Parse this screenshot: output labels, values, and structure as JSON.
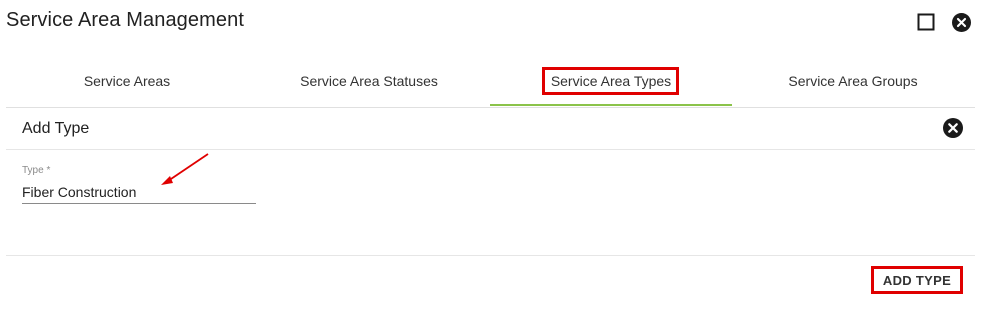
{
  "dialog": {
    "title": "Service Area Management",
    "maximize_icon": "square-outline-icon",
    "close_icon": "close-circle-icon"
  },
  "tabs": [
    {
      "label": "Service Areas",
      "active": false
    },
    {
      "label": "Service Area Statuses",
      "active": false
    },
    {
      "label": "Service Area Types",
      "active": true
    },
    {
      "label": "Service Area Groups",
      "active": false
    }
  ],
  "panel": {
    "title": "Add Type",
    "close_icon": "close-circle-icon"
  },
  "form": {
    "type_label": "Type *",
    "type_value": "Fiber Construction"
  },
  "footer": {
    "add_button_label": "ADD TYPE"
  },
  "colors": {
    "accent_ink": "#8bc34a",
    "annotation": "#e00000"
  }
}
